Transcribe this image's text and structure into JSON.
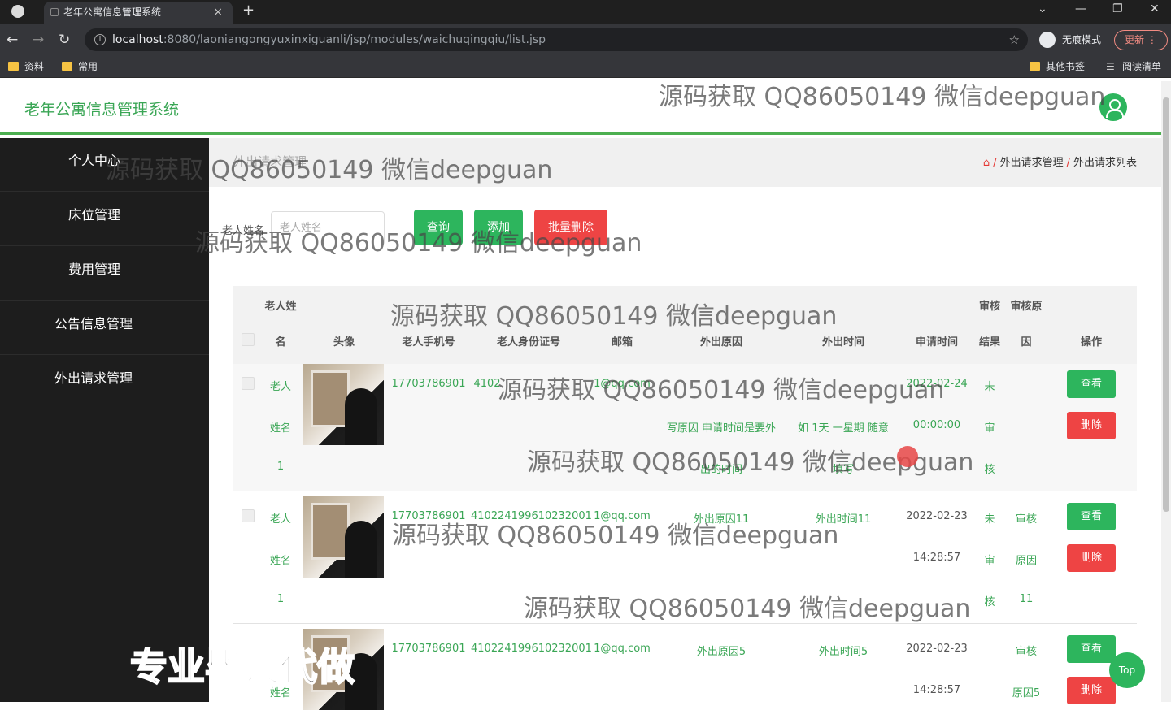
{
  "browser": {
    "tab_title": "老年公寓信息管理系统",
    "tab_close": "×",
    "new_tab": "+",
    "url_host": "localhost",
    "url_path": ":8080/laoniangongyuxinxiguanli/jsp/modules/waichuqingqiu/list.jsp",
    "incognito_label": "无痕模式",
    "update_label": "更新",
    "bookmarks": [
      "资料",
      "常用"
    ],
    "bookmarks_right": [
      "其他书签",
      "阅读清单"
    ]
  },
  "app": {
    "title": "老年公寓信息管理系统"
  },
  "sidebar": {
    "items": [
      {
        "label": "个人中心"
      },
      {
        "label": "床位管理"
      },
      {
        "label": "费用管理"
      },
      {
        "label": "公告信息管理"
      },
      {
        "label": "外出请求管理"
      }
    ]
  },
  "breadcrumb": {
    "page_title": "外出请求管理",
    "path": [
      "外出请求管理",
      "外出请求列表"
    ]
  },
  "search": {
    "label": "老人姓名",
    "placeholder": "老人姓名",
    "query_button": "查询",
    "add_button": "添加",
    "batch_delete_button": "批量删除"
  },
  "table": {
    "headers": {
      "name": [
        "老人姓",
        "名"
      ],
      "avatar": "头像",
      "phone": "老人手机号",
      "idcard": "老人身份证号",
      "email": "邮箱",
      "reason": "外出原因",
      "out_time": "外出时间",
      "apply_time": "申请时间",
      "audit_result": [
        "审核",
        "结果"
      ],
      "audit_reason": [
        "审核原",
        "因"
      ],
      "ops": "操作"
    },
    "rows": [
      {
        "name": [
          "老人",
          "姓名",
          "1"
        ],
        "phone": "17703786901",
        "idcard": "4102",
        "email": "1@qq.com",
        "reason": [
          "写原因 申请时间是要外",
          "出的时间"
        ],
        "out_time": [
          "如 1天 一星期 随意",
          "填写"
        ],
        "apply_time": [
          "2022-02-24",
          "00:00:00"
        ],
        "audit_result": [
          "未",
          "审",
          "核"
        ],
        "audit_reason": "",
        "view": "查看",
        "delete": "删除"
      },
      {
        "name": [
          "老人",
          "姓名",
          "1"
        ],
        "phone": "17703786901",
        "idcard": "410224199610232001",
        "email": "1@qq.com",
        "reason": [
          "外出原因11"
        ],
        "out_time": [
          "外出时间11"
        ],
        "apply_time": [
          "2022-02-23",
          "14:28:57"
        ],
        "audit_result": [
          "未",
          "审",
          "核"
        ],
        "audit_reason": [
          "审核",
          "原因",
          "11"
        ],
        "view": "查看",
        "delete": "删除"
      },
      {
        "name": [
          "",
          "姓名",
          ""
        ],
        "phone": "17703786901",
        "idcard": "410224199610232001",
        "email": "1@qq.com",
        "reason": [
          "外出原因5"
        ],
        "out_time": [
          "外出时间5"
        ],
        "apply_time": [
          "2022-02-23",
          "14:28:57"
        ],
        "audit_result": [
          "",
          "",
          ""
        ],
        "audit_reason": [
          "审核",
          "原因5"
        ],
        "view": "查看",
        "delete": "删除"
      }
    ]
  },
  "watermark": "源码获取 QQ86050149 微信deepguan",
  "watermark_big": "专业毕设代做",
  "top_button": "Top",
  "colors": {
    "accent": "#2db55d",
    "danger": "#ee4444",
    "sidebar_bg": "#1d1d1d"
  }
}
